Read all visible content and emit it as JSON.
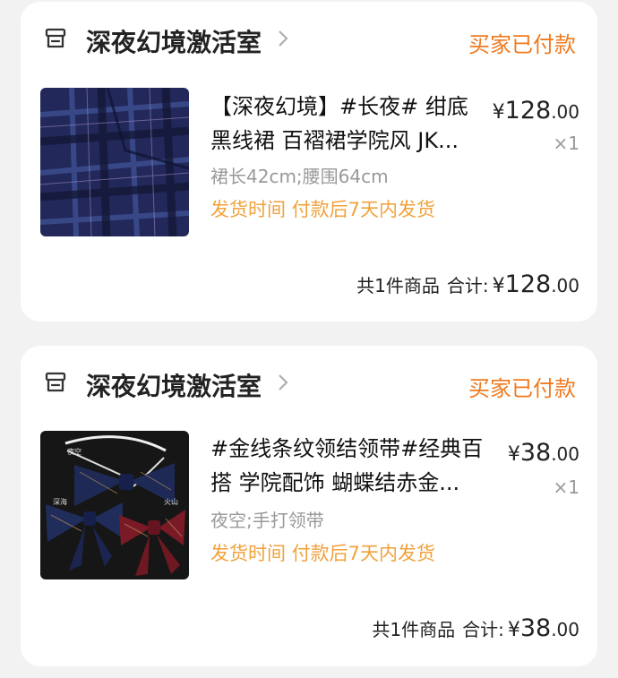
{
  "orders": [
    {
      "store_name": "深夜幻境激活室",
      "status": "买家已付款",
      "item": {
        "title": "【深夜幻境】#长夜# 绀底黑线裙 百褶裙学院风 JK...",
        "sku": "裙长42cm;腰围64cm",
        "shipping": "发货时间 付款后7天内发货",
        "price_currency": "¥",
        "price_int": "128",
        "price_dec": ".00",
        "quantity": "×1"
      },
      "summary": {
        "count": "共1件商品",
        "label": "合计:",
        "currency": "¥",
        "total_int": "128",
        "total_dec": ".00"
      }
    },
    {
      "store_name": "深夜幻境激活室",
      "status": "买家已付款",
      "item": {
        "title": "#金线条纹领结领带#经典百搭 学院配饰 蝴蝶结赤金...",
        "sku": "夜空;手打领带",
        "shipping": "发货时间 付款后7天内发货",
        "price_currency": "¥",
        "price_int": "38",
        "price_dec": ".00",
        "quantity": "×1",
        "image_labels": [
          "夜空",
          "深海",
          "火山"
        ]
      },
      "summary": {
        "count": "共1件商品",
        "label": "合计:",
        "currency": "¥",
        "total_int": "38",
        "total_dec": ".00"
      }
    }
  ],
  "icons": {
    "store": "store-icon",
    "chevron": "chevron-right-icon"
  },
  "colors": {
    "status": "#f07a1f",
    "shipping": "#f0a23c",
    "muted": "#999999",
    "card_bg": "#ffffff",
    "page_bg": "#f2f2f2"
  }
}
